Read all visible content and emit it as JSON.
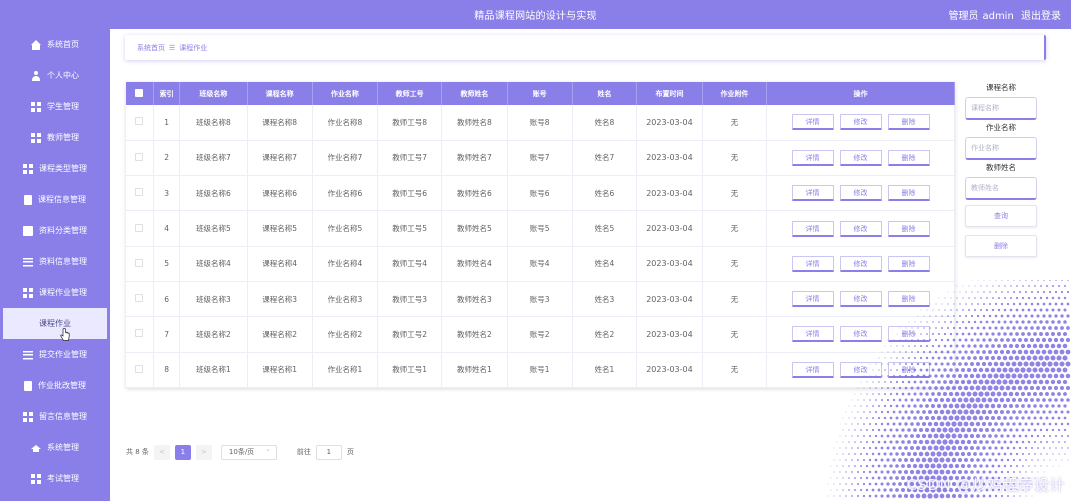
{
  "header": {
    "title": "精品课程网站的设计与实现",
    "user_role": "管理员",
    "username": "admin",
    "logout": "退出登录"
  },
  "sidebar": {
    "items": [
      {
        "label": "系统首页",
        "icon": "home-icon"
      },
      {
        "label": "个人中心",
        "icon": "user-icon"
      },
      {
        "label": "学生管理",
        "icon": "grid-icon"
      },
      {
        "label": "教师管理",
        "icon": "grid-icon"
      },
      {
        "label": "课程类型管理",
        "icon": "grid-icon"
      },
      {
        "label": "课程信息管理",
        "icon": "document-icon"
      },
      {
        "label": "资料分类管理",
        "icon": "box-icon"
      },
      {
        "label": "资料信息管理",
        "icon": "list-icon"
      },
      {
        "label": "课程作业管理",
        "icon": "grid-icon"
      },
      {
        "label": "课程作业",
        "icon": ""
      },
      {
        "label": "提交作业管理",
        "icon": "list-icon"
      },
      {
        "label": "作业批改管理",
        "icon": "document-icon"
      },
      {
        "label": "留言信息管理",
        "icon": "grid-icon"
      },
      {
        "label": "系统管理",
        "icon": "hat-icon"
      },
      {
        "label": "考试管理",
        "icon": "grid-icon"
      }
    ]
  },
  "breadcrumb": {
    "home": "系统首页",
    "separator": "☰",
    "current": "课程作业"
  },
  "table": {
    "headers": [
      "索引",
      "班级名称",
      "课程名称",
      "作业名称",
      "教师工号",
      "教师姓名",
      "账号",
      "姓名",
      "布置时间",
      "作业附件",
      "操作"
    ],
    "rows": [
      [
        "1",
        "班级名称8",
        "课程名称8",
        "作业名称8",
        "教师工号8",
        "教师姓名8",
        "账号8",
        "姓名8",
        "2023-03-04",
        "无"
      ],
      [
        "2",
        "班级名称7",
        "课程名称7",
        "作业名称7",
        "教师工号7",
        "教师姓名7",
        "账号7",
        "姓名7",
        "2023-03-04",
        "无"
      ],
      [
        "3",
        "班级名称6",
        "课程名称6",
        "作业名称6",
        "教师工号6",
        "教师姓名6",
        "账号6",
        "姓名6",
        "2023-03-04",
        "无"
      ],
      [
        "4",
        "班级名称5",
        "课程名称5",
        "作业名称5",
        "教师工号5",
        "教师姓名5",
        "账号5",
        "姓名5",
        "2023-03-04",
        "无"
      ],
      [
        "5",
        "班级名称4",
        "课程名称4",
        "作业名称4",
        "教师工号4",
        "教师姓名4",
        "账号4",
        "姓名4",
        "2023-03-04",
        "无"
      ],
      [
        "6",
        "班级名称3",
        "课程名称3",
        "作业名称3",
        "教师工号3",
        "教师姓名3",
        "账号3",
        "姓名3",
        "2023-03-04",
        "无"
      ],
      [
        "7",
        "班级名称2",
        "课程名称2",
        "作业名称2",
        "教师工号2",
        "教师姓名2",
        "账号2",
        "姓名2",
        "2023-03-04",
        "无"
      ],
      [
        "8",
        "班级名称1",
        "课程名称1",
        "作业名称1",
        "教师工号1",
        "教师姓名1",
        "账号1",
        "姓名1",
        "2023-03-04",
        "无"
      ]
    ],
    "actions": {
      "detail": "详情",
      "edit": "修改",
      "delete": "删除"
    }
  },
  "search": {
    "course_label": "课程名称",
    "course_placeholder": "课程名称",
    "homework_label": "作业名称",
    "homework_placeholder": "作业名称",
    "teacher_label": "教师姓名",
    "teacher_placeholder": "教师姓名",
    "query_button": "查询",
    "delete_button": "删除"
  },
  "pagination": {
    "total": "共 8 条",
    "prev": "<",
    "current_page": "1",
    "next": ">",
    "page_size": "10条/页",
    "goto_label": "前往",
    "goto_value": "1",
    "page_unit": "页"
  },
  "watermark": "CSDN @炒鸡程序设计",
  "colors": {
    "primary": "#8a7fe8",
    "sidebar_active": "#ebe9ff",
    "text": "#606266"
  }
}
